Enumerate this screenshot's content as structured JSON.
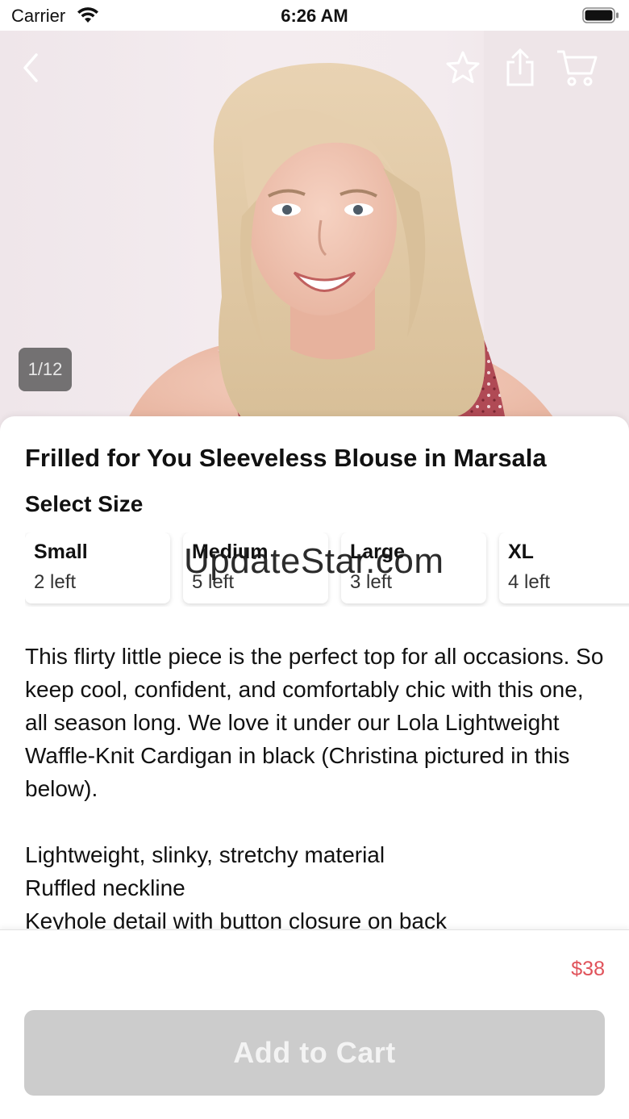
{
  "status_bar": {
    "carrier": "Carrier",
    "time": "6:26 AM",
    "icons": [
      "wifi-icon",
      "battery-icon"
    ]
  },
  "gallery": {
    "counter": "1/12",
    "icons": [
      "back-icon",
      "star-icon",
      "share-icon",
      "cart-icon"
    ]
  },
  "product": {
    "title": "Frilled for You Sleeveless Blouse in Marsala",
    "select_size_label": "Select Size",
    "sizes": [
      {
        "name": "Small",
        "stock": "2 left"
      },
      {
        "name": "Medium",
        "stock": "5 left"
      },
      {
        "name": "Large",
        "stock": "3 left"
      },
      {
        "name": "XL",
        "stock": "4 left"
      }
    ],
    "description": {
      "paragraph": "This flirty little piece is the perfect top for all occasions. So keep cool, confident, and comfortably chic with this one, all season long. We love it under our Lola Lightweight Waffle-Knit Cardigan in black (Christina pictured in this below).",
      "features": [
        "Lightweight, slinky, stretchy material",
        "Ruffled neckline",
        "Keyhole detail with button closure on back"
      ]
    }
  },
  "watermark": "UpdateStar.com",
  "purchase": {
    "price": "$38",
    "add_to_cart_label": "Add to Cart"
  },
  "colors": {
    "price": "#e0525a",
    "button_disabled": "#cccccc",
    "blouse": "#b04a55"
  }
}
